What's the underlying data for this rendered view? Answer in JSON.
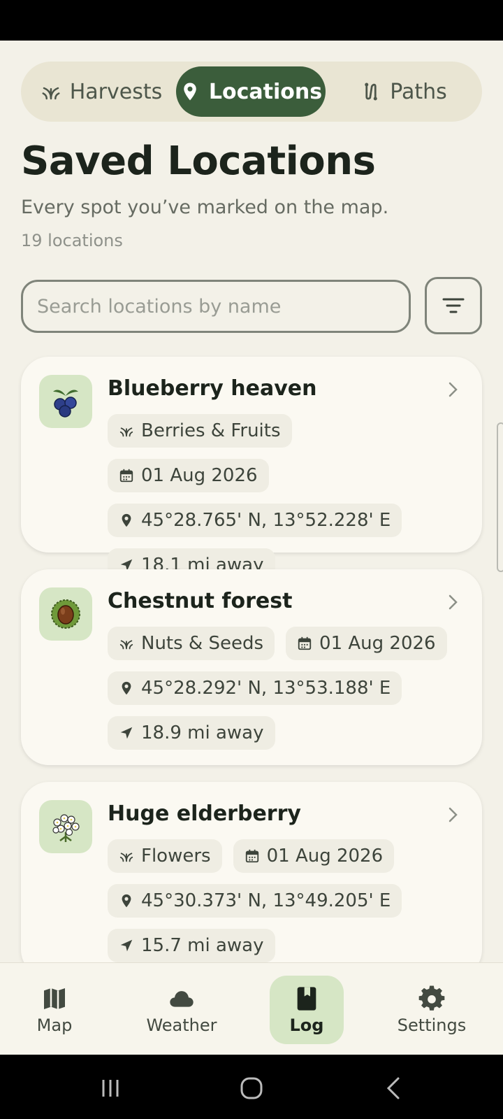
{
  "tabs": [
    {
      "label": "Harvests",
      "icon": "sprout-icon",
      "selected": false
    },
    {
      "label": "Locations",
      "icon": "location-pin-icon",
      "selected": true
    },
    {
      "label": "Paths",
      "icon": "route-icon",
      "selected": false
    }
  ],
  "header": {
    "title": "Saved Locations",
    "subtitle": "Every spot you’ve marked on the map.",
    "count": "19 locations"
  },
  "search": {
    "placeholder": "Search locations by name",
    "value": ""
  },
  "filter_icon": "filter-icon",
  "locations": [
    {
      "name": "Blueberry heaven",
      "icon": "blueberry-icon",
      "category": "Berries & Fruits",
      "date": "01 Aug 2026",
      "coords": "45°28.765' N, 13°52.228' E",
      "distance": "18.1 mi away"
    },
    {
      "name": "Chestnut forest",
      "icon": "chestnut-icon",
      "category": "Nuts & Seeds",
      "date": "01 Aug 2026",
      "coords": "45°28.292' N, 13°53.188' E",
      "distance": "18.9 mi away"
    },
    {
      "name": "Huge elderberry",
      "icon": "elderflower-icon",
      "category": "Flowers",
      "date": "01 Aug 2026",
      "coords": "45°30.373' N, 13°49.205' E",
      "distance": "15.7 mi away"
    }
  ],
  "bottom_nav": [
    {
      "label": "Map",
      "icon": "map-icon",
      "selected": false
    },
    {
      "label": "Weather",
      "icon": "cloud-icon",
      "selected": false
    },
    {
      "label": "Log",
      "icon": "book-icon",
      "selected": true
    },
    {
      "label": "Settings",
      "icon": "gear-icon",
      "selected": false
    }
  ],
  "colors": {
    "accent": "#3b5d3b",
    "background": "#f3f1e8",
    "card": "#fbf9f2",
    "chip": "#efede3",
    "icon_bg": "#d6e6c5"
  }
}
